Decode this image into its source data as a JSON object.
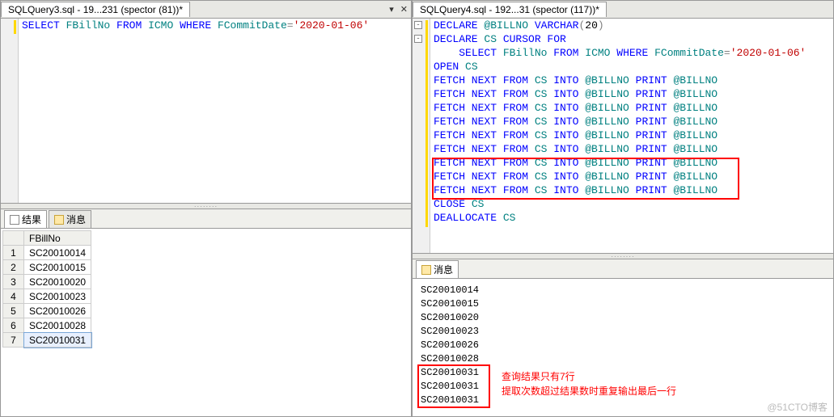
{
  "left": {
    "tabTitle": "SQLQuery3.sql - 19...231 (spector (81))*",
    "code": {
      "select": "SELECT",
      "col": "FBillNo",
      "from": "FROM",
      "tbl": "ICMO",
      "where": "WHERE",
      "fcol": "FCommitDate",
      "eq": "=",
      "date": "'2020-01-06'"
    },
    "resultsTab": "结果",
    "messagesTab": "消息",
    "header": "FBillNo",
    "rows": [
      "SC20010014",
      "SC20010015",
      "SC20010020",
      "SC20010023",
      "SC20010026",
      "SC20010028",
      "SC20010031"
    ]
  },
  "right": {
    "tabTitle": "SQLQuery4.sql - 192...31 (spector (117))*",
    "lines": [
      {
        "t": [
          [
            "kw",
            "DECLARE "
          ],
          [
            "obj",
            "@BILLNO "
          ],
          [
            "kw",
            "VARCHAR"
          ],
          [
            "op",
            "("
          ],
          [
            "num",
            "20"
          ],
          [
            "op",
            ")"
          ]
        ]
      },
      {
        "t": [
          [
            "kw",
            "DECLARE "
          ],
          [
            "obj",
            "CS "
          ],
          [
            "kw",
            "CURSOR FOR"
          ]
        ]
      },
      {
        "t": [
          [
            "",
            "    "
          ],
          [
            "kw",
            "SELECT "
          ],
          [
            "fn",
            "FBillNo "
          ],
          [
            "kw",
            "FROM "
          ],
          [
            "fn",
            "ICMO "
          ],
          [
            "kw",
            "WHERE "
          ],
          [
            "fn",
            "FCommitDate"
          ],
          [
            "op",
            "="
          ],
          [
            "str",
            "'2020-01-06'"
          ]
        ]
      },
      {
        "t": [
          [
            "kw",
            "OPEN "
          ],
          [
            "obj",
            "CS"
          ]
        ]
      },
      {
        "t": [
          [
            "kw",
            "FETCH NEXT FROM "
          ],
          [
            "obj",
            "CS "
          ],
          [
            "kw",
            "INTO "
          ],
          [
            "obj",
            "@BILLNO "
          ],
          [
            "kw",
            "PRINT "
          ],
          [
            "obj",
            "@BILLNO"
          ]
        ]
      },
      {
        "t": [
          [
            "kw",
            "FETCH NEXT FROM "
          ],
          [
            "obj",
            "CS "
          ],
          [
            "kw",
            "INTO "
          ],
          [
            "obj",
            "@BILLNO "
          ],
          [
            "kw",
            "PRINT "
          ],
          [
            "obj",
            "@BILLNO"
          ]
        ]
      },
      {
        "t": [
          [
            "kw",
            "FETCH NEXT FROM "
          ],
          [
            "obj",
            "CS "
          ],
          [
            "kw",
            "INTO "
          ],
          [
            "obj",
            "@BILLNO "
          ],
          [
            "kw",
            "PRINT "
          ],
          [
            "obj",
            "@BILLNO"
          ]
        ]
      },
      {
        "t": [
          [
            "kw",
            "FETCH NEXT FROM "
          ],
          [
            "obj",
            "CS "
          ],
          [
            "kw",
            "INTO "
          ],
          [
            "obj",
            "@BILLNO "
          ],
          [
            "kw",
            "PRINT "
          ],
          [
            "obj",
            "@BILLNO"
          ]
        ]
      },
      {
        "t": [
          [
            "kw",
            "FETCH NEXT FROM "
          ],
          [
            "obj",
            "CS "
          ],
          [
            "kw",
            "INTO "
          ],
          [
            "obj",
            "@BILLNO "
          ],
          [
            "kw",
            "PRINT "
          ],
          [
            "obj",
            "@BILLNO"
          ]
        ]
      },
      {
        "t": [
          [
            "kw",
            "FETCH NEXT FROM "
          ],
          [
            "obj",
            "CS "
          ],
          [
            "kw",
            "INTO "
          ],
          [
            "obj",
            "@BILLNO "
          ],
          [
            "kw",
            "PRINT "
          ],
          [
            "obj",
            "@BILLNO"
          ]
        ]
      },
      {
        "t": [
          [
            "kw",
            "FETCH NEXT FROM "
          ],
          [
            "obj",
            "CS "
          ],
          [
            "kw",
            "INTO "
          ],
          [
            "obj",
            "@BILLNO "
          ],
          [
            "kw",
            "PRINT "
          ],
          [
            "obj",
            "@BILLNO"
          ]
        ]
      },
      {
        "t": [
          [
            "kw",
            "FETCH NEXT FROM "
          ],
          [
            "obj",
            "CS "
          ],
          [
            "kw",
            "INTO "
          ],
          [
            "obj",
            "@BILLNO "
          ],
          [
            "kw",
            "PRINT "
          ],
          [
            "obj",
            "@BILLNO"
          ]
        ]
      },
      {
        "t": [
          [
            "kw",
            "FETCH NEXT FROM "
          ],
          [
            "obj",
            "CS "
          ],
          [
            "kw",
            "INTO "
          ],
          [
            "obj",
            "@BILLNO "
          ],
          [
            "kw",
            "PRINT "
          ],
          [
            "obj",
            "@BILLNO"
          ]
        ]
      },
      {
        "t": [
          [
            "kw",
            "CLOSE "
          ],
          [
            "obj",
            "CS"
          ]
        ]
      },
      {
        "t": [
          [
            "kw",
            "DEALLOCATE "
          ],
          [
            "obj",
            "CS"
          ]
        ]
      }
    ],
    "messagesTab": "消息",
    "msgs": [
      "SC20010014",
      "SC20010015",
      "SC20010020",
      "SC20010023",
      "SC20010026",
      "SC20010028",
      "SC20010031",
      "SC20010031",
      "SC20010031"
    ],
    "anno1": "查询结果只有7行",
    "anno2": "提取次数超过结果数时重复输出最后一行"
  },
  "watermark": "@51CTO博客"
}
